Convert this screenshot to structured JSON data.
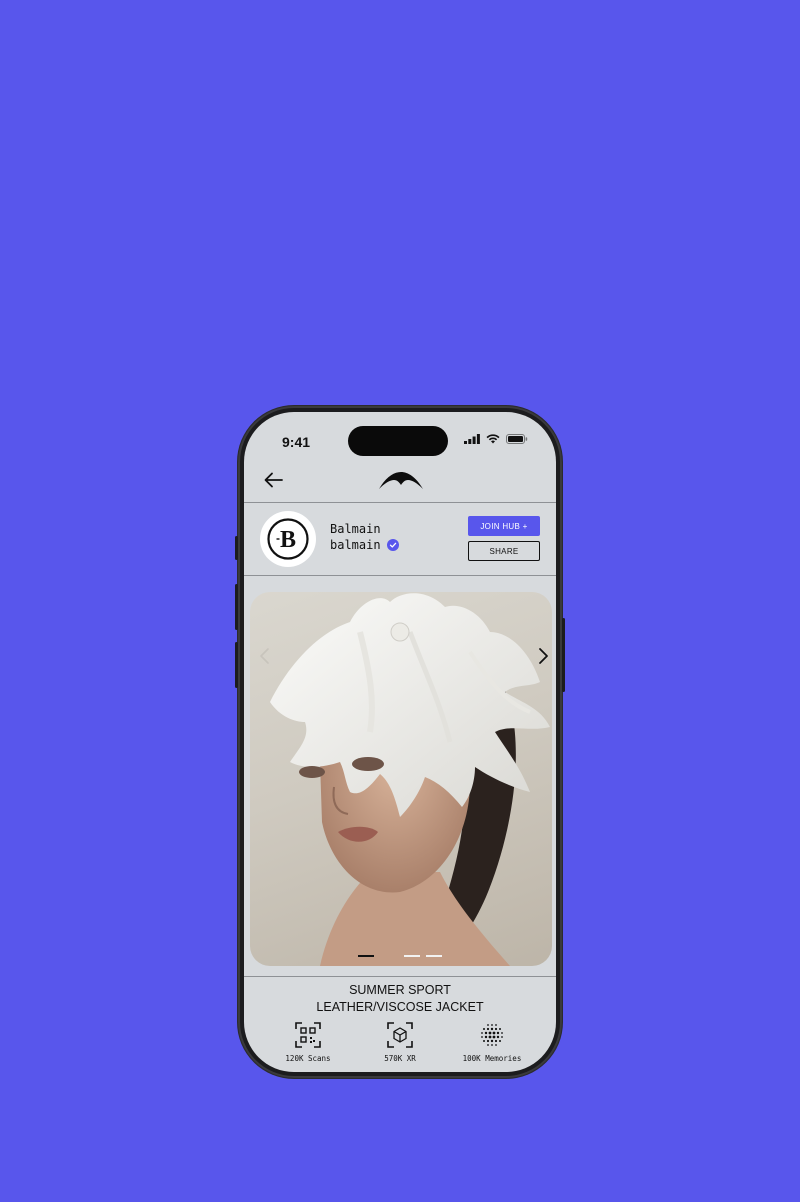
{
  "status_bar": {
    "time": "9:41"
  },
  "nav": {
    "back_icon": "arrow-left-icon",
    "logo_icon": "wing-logo-icon"
  },
  "profile": {
    "name": "Balmain",
    "handle": "balmain",
    "verified": true,
    "join_label": "JOIN HUB +",
    "share_label": "SHARE",
    "logo_letter": "B"
  },
  "carousel": {
    "slides": 3,
    "active": 0
  },
  "product": {
    "line1": "SUMMER SPORT",
    "line2": "LEATHER/VISCOSE JACKET"
  },
  "stats": [
    {
      "icon": "qr-code-icon",
      "label": "120K Scans"
    },
    {
      "icon": "cube-icon",
      "label": "570K XR"
    },
    {
      "icon": "dot-matrix-icon",
      "label": "100K Memories"
    }
  ],
  "colors": {
    "accent": "#5856EC",
    "screen": "#D7DADD",
    "background": "#5856EC"
  }
}
